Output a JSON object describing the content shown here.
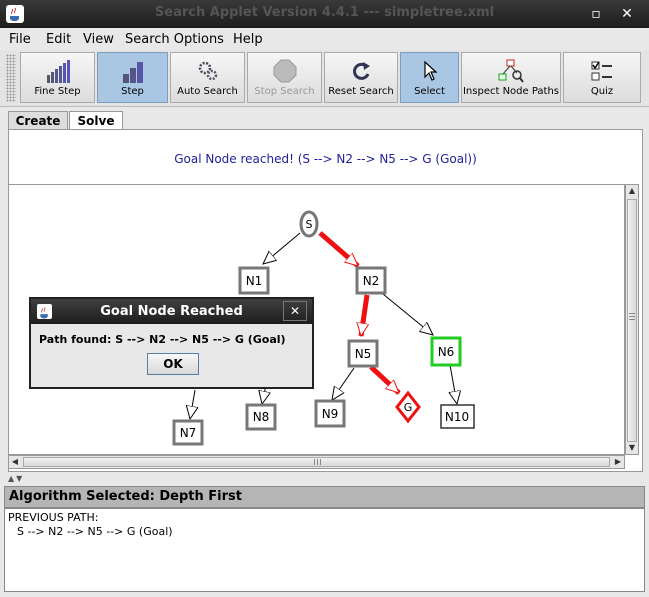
{
  "window": {
    "title": "Search Applet Version 4.4.1 --- simpletree.xml"
  },
  "menu": [
    "File",
    "Edit",
    "View",
    "Search Options",
    "Help"
  ],
  "toolbar": {
    "fine_step": "Fine Step",
    "step": "Step",
    "auto_search": "Auto Search",
    "stop_search": "Stop Search",
    "reset_search": "Reset Search",
    "select": "Select",
    "inspect_node_paths": "Inspect Node Paths",
    "quiz": "Quiz"
  },
  "tabs": {
    "create": "Create",
    "solve": "Solve"
  },
  "status_message": "Goal Node reached! (S --> N2 --> N5 --> G (Goal))",
  "graph": {
    "nodes": {
      "S": "S",
      "N1": "N1",
      "N2": "N2",
      "N5": "N5",
      "N6": "N6",
      "N7": "N7",
      "N8": "N8",
      "N9": "N9",
      "N10": "N10",
      "G": "G"
    },
    "colors": {
      "path": "#ee1111",
      "goal_border": "#ee1111",
      "frontier_border": "#22cc22",
      "visited_border": "#777777"
    }
  },
  "dialog": {
    "title": "Goal Node Reached",
    "message": "Path found: S --> N2 --> N5 --> G (Goal)",
    "ok": "OK"
  },
  "algorithm": "Algorithm Selected: Depth First",
  "info": {
    "heading": "PREVIOUS PATH:",
    "path": "S --> N2 --> N5 --> G (Goal)"
  }
}
